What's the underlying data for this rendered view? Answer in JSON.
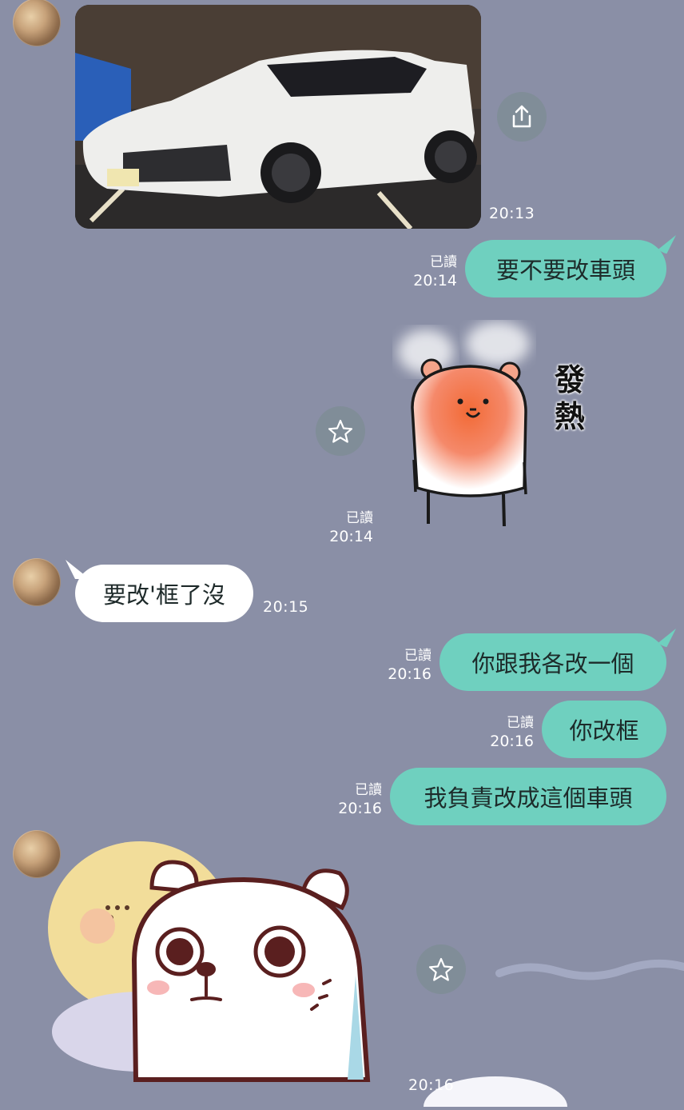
{
  "messages": {
    "m1": {
      "time": "20:13"
    },
    "m2": {
      "text": "要不要改車頭",
      "read": "已讀",
      "time": "20:14"
    },
    "m3": {
      "sticker_text": "發熱",
      "read": "已讀",
      "time": "20:14"
    },
    "m4": {
      "text": "要改'框了沒",
      "time": "20:15"
    },
    "m5": {
      "text": "你跟我各改一個",
      "read": "已讀",
      "time": "20:16"
    },
    "m6": {
      "text": "你改框",
      "read": "已讀",
      "time": "20:16"
    },
    "m7": {
      "text": "我負責改成這個車頭",
      "read": "已讀",
      "time": "20:16"
    },
    "m8": {
      "time": "20:16"
    }
  },
  "icons": {
    "share": "share-icon",
    "star": "star-icon"
  },
  "colors": {
    "background": "#8a8fa6",
    "my_bubble": "#6fd0bf",
    "their_bubble": "#ffffff"
  }
}
